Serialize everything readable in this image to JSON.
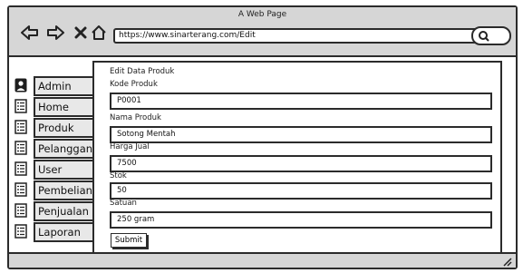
{
  "window": {
    "title": "A Web Page"
  },
  "toolbar": {
    "back_icon": "arrow-left-icon",
    "forward_icon": "arrow-right-icon",
    "close_icon": "x-icon",
    "home_icon": "home-icon",
    "url": "https://www.sinarterang.com/Edit",
    "search_icon": "search-icon"
  },
  "sidebar": {
    "items": [
      {
        "label": "Admin",
        "icon": "user-icon"
      },
      {
        "label": "Home",
        "icon": "list-icon"
      },
      {
        "label": "Produk",
        "icon": "list-icon"
      },
      {
        "label": "Pelanggan",
        "icon": "list-icon"
      },
      {
        "label": "User",
        "icon": "list-icon"
      },
      {
        "label": "Pembelian",
        "icon": "list-icon"
      },
      {
        "label": "Penjualan",
        "icon": "list-icon"
      },
      {
        "label": "Laporan",
        "icon": "list-icon"
      }
    ]
  },
  "form": {
    "title": "Edit Data Produk",
    "fields": [
      {
        "label": "Kode Produk",
        "value": "P0001"
      },
      {
        "label": "Nama Produk",
        "value": "Sotong Mentah"
      },
      {
        "label": "Harga Jual",
        "value": "7500"
      },
      {
        "label": "Stok",
        "value": "50"
      },
      {
        "label": "Satuan",
        "value": "250 gram"
      }
    ],
    "submit_label": "Submit"
  }
}
